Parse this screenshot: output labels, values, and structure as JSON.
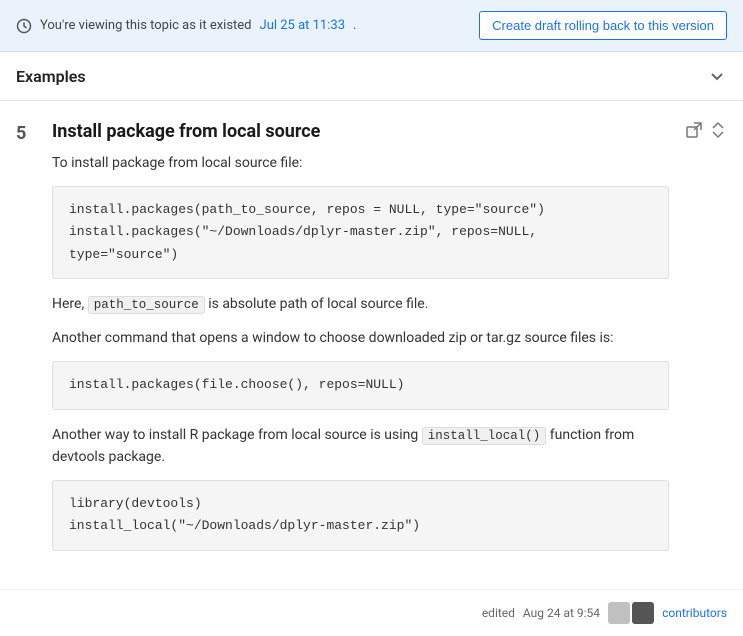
{
  "banner": {
    "viewing_text": "You're viewing this topic as it existed",
    "date_link": "Jul 25 at 11:33",
    "button_label": "Create draft rolling back to this version"
  },
  "section": {
    "title": "Examples",
    "collapse_icon": "chevron-down"
  },
  "entry": {
    "number": "5",
    "title": "Install package from local source",
    "intro_text": "To install package from local source file:",
    "code_block_1": {
      "lines": [
        "install.packages(path_to_source, repos = NULL, type=\"source\")",
        "install.packages(\"~/Downloads/dplyr-master.zip\", repos=NULL, type=\"source\")"
      ]
    },
    "note_text_1_before": "Here,",
    "note_inline_code": "path_to_source",
    "note_text_1_after": "is absolute path of local source file.",
    "note_text_2": "Another command that opens a window to choose downloaded zip or tar.gz source files is:",
    "code_block_2": {
      "lines": [
        "install.packages(file.choose(), repos=NULL)"
      ]
    },
    "note_text_3_before": "Another way to install R package from local source is using",
    "note_inline_code_2": "install_local()",
    "note_text_3_after": "function from devtools package.",
    "code_block_3": {
      "lines": [
        "library(devtools)",
        "install_local(\"~/Downloads/dplyr-master.zip\")"
      ]
    }
  },
  "footer": {
    "edited_label": "edited",
    "date": "Aug 24 at 9:54",
    "contributors_label": "contributors"
  }
}
